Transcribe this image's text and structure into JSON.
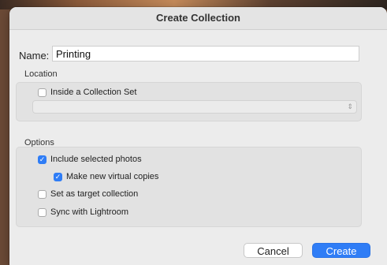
{
  "colors": {
    "accent": "#2f7df6",
    "dialog_bg": "#ececec",
    "group_bg": "#e2e2e2"
  },
  "dialog": {
    "title": "Create Collection"
  },
  "name": {
    "label": "Name:",
    "value": "Printing"
  },
  "location": {
    "section_label": "Location",
    "inside_set": {
      "label": "Inside a Collection Set",
      "checked": false
    },
    "collection_set_select": {
      "selected": "",
      "icon": "updown-chevron-icon"
    }
  },
  "options": {
    "section_label": "Options",
    "include_selected": {
      "label": "Include selected photos",
      "checked": true
    },
    "virtual_copies": {
      "label": "Make new virtual copies",
      "checked": true
    },
    "target_collection": {
      "label": "Set as target collection",
      "checked": false
    },
    "sync_lightroom": {
      "label": "Sync with Lightroom",
      "checked": false
    }
  },
  "buttons": {
    "cancel": "Cancel",
    "create": "Create"
  }
}
